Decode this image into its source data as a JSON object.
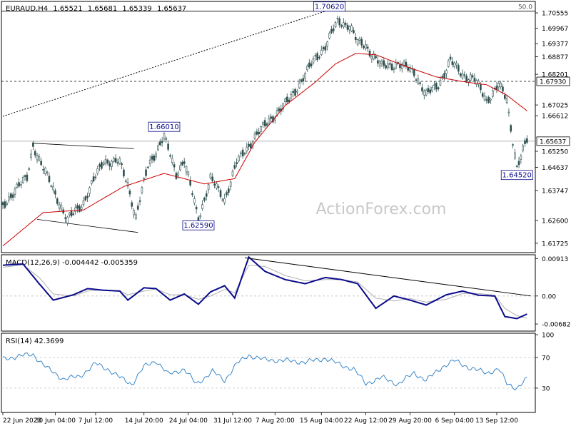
{
  "chart_data": {
    "type": "candlestick",
    "header": {
      "symbol": "EURAUD,H4",
      "open": "1.65521",
      "high": "1.65681",
      "low": "1.65339",
      "close": "1.65637"
    },
    "watermark": "ActionForex.com",
    "colors": {
      "candle": "#2f4f4f",
      "ma": "#cc0000",
      "macd": "#0a0a8c",
      "signal": "#b0b0b0",
      "rsi": "#3a87c9",
      "label_border": "#0a0a8c",
      "label_text": "#0a0a8c",
      "frame": "#000000"
    },
    "price_panel": {
      "ylim": [
        1.6142,
        1.7094
      ],
      "ticks": [
        "1.70555",
        "1.69967",
        "1.69377",
        "1.68877",
        "1.68201",
        "1.67025",
        "1.66612",
        "1.65250",
        "1.64637",
        "1.63747",
        "1.62600",
        "1.61725"
      ],
      "tick_values": [
        1.70555,
        1.69967,
        1.69377,
        1.68877,
        1.68201,
        1.67025,
        1.66612,
        1.6525,
        1.64637,
        1.63747,
        1.626,
        1.61725
      ],
      "current_price_label": "1.65637",
      "current_price": 1.65637,
      "level_label": "1.67930",
      "level": 1.6793,
      "fib_label": "50.0",
      "fib_level": 1.7062,
      "annotations": [
        {
          "label": "1.70620",
          "value": 1.7062,
          "bar": 162
        },
        {
          "label": "1.66010",
          "value": 1.6601,
          "bar": 80
        },
        {
          "label": "1.62590",
          "value": 1.6259,
          "bar": 97
        },
        {
          "label": "1.64520",
          "value": 1.6452,
          "bar": 255
        }
      ],
      "channel": [
        {
          "from": {
            "bar": 15,
            "value": 1.6556
          },
          "to": {
            "bar": 65,
            "value": 1.6535
          }
        },
        {
          "from": {
            "bar": 17,
            "value": 1.6264
          },
          "to": {
            "bar": 67,
            "value": 1.6214
          }
        }
      ],
      "trendline": {
        "from": {
          "bar": 0,
          "value": 1.6659
        },
        "to": {
          "bar": 160,
          "value": 1.7062
        }
      },
      "ma_points": [
        [
          0,
          1.6162
        ],
        [
          20,
          1.629
        ],
        [
          40,
          1.63
        ],
        [
          60,
          1.639
        ],
        [
          80,
          1.644
        ],
        [
          100,
          1.64
        ],
        [
          115,
          1.642
        ],
        [
          125,
          1.656
        ],
        [
          140,
          1.67
        ],
        [
          155,
          1.679
        ],
        [
          165,
          1.686
        ],
        [
          175,
          1.69
        ],
        [
          185,
          1.6895
        ],
        [
          200,
          1.685
        ],
        [
          215,
          1.681
        ],
        [
          230,
          1.679
        ],
        [
          240,
          1.678
        ],
        [
          250,
          1.674
        ],
        [
          260,
          1.668
        ]
      ],
      "price_points": [
        [
          0,
          1.631
        ],
        [
          6,
          1.638
        ],
        [
          12,
          1.642
        ],
        [
          15,
          1.655
        ],
        [
          20,
          1.646
        ],
        [
          25,
          1.638
        ],
        [
          32,
          1.626
        ],
        [
          40,
          1.633
        ],
        [
          50,
          1.649
        ],
        [
          58,
          1.648
        ],
        [
          62,
          1.64
        ],
        [
          66,
          1.627
        ],
        [
          72,
          1.647
        ],
        [
          80,
          1.658
        ],
        [
          86,
          1.644
        ],
        [
          90,
          1.649
        ],
        [
          97,
          1.6265
        ],
        [
          103,
          1.642
        ],
        [
          110,
          1.634
        ],
        [
          116,
          1.648
        ],
        [
          125,
          1.658
        ],
        [
          133,
          1.665
        ],
        [
          142,
          1.672
        ],
        [
          150,
          1.682
        ],
        [
          155,
          1.688
        ],
        [
          160,
          1.693
        ],
        [
          166,
          1.702
        ],
        [
          172,
          1.701
        ],
        [
          176,
          1.694
        ],
        [
          180,
          1.693
        ],
        [
          188,
          1.685
        ],
        [
          196,
          1.686
        ],
        [
          204,
          1.683
        ],
        [
          210,
          1.674
        ],
        [
          216,
          1.678
        ],
        [
          222,
          1.687
        ],
        [
          228,
          1.682
        ],
        [
          234,
          1.68
        ],
        [
          240,
          1.672
        ],
        [
          246,
          1.678
        ],
        [
          250,
          1.672
        ],
        [
          255,
          1.6465
        ],
        [
          260,
          1.6565
        ]
      ]
    },
    "macd_panel": {
      "label": "MACD(12,26,9) -0.004442 -0.005359",
      "ylim": [
        -0.0082,
        0.0097
      ],
      "ticks": [
        "0.00913",
        "0.00",
        "-0.006823"
      ],
      "tick_values": [
        0.00913,
        0.0,
        -0.006823
      ],
      "macd_points": [
        [
          0,
          0.0075
        ],
        [
          10,
          0.0078
        ],
        [
          18,
          0.003
        ],
        [
          25,
          -0.001
        ],
        [
          35,
          0.0003
        ],
        [
          42,
          0.0018
        ],
        [
          50,
          0.0014
        ],
        [
          58,
          0.0012
        ],
        [
          62,
          -0.001
        ],
        [
          70,
          0.002
        ],
        [
          76,
          0.0018
        ],
        [
          83,
          -0.001
        ],
        [
          90,
          0.0005
        ],
        [
          97,
          -0.002
        ],
        [
          103,
          0.001
        ],
        [
          110,
          0.0025
        ],
        [
          115,
          -0.0005
        ],
        [
          122,
          0.0095
        ],
        [
          130,
          0.006
        ],
        [
          140,
          0.004
        ],
        [
          150,
          0.003
        ],
        [
          160,
          0.0045
        ],
        [
          168,
          0.004
        ],
        [
          176,
          0.003
        ],
        [
          185,
          -0.003
        ],
        [
          194,
          0.0
        ],
        [
          202,
          -0.001
        ],
        [
          210,
          -0.0022
        ],
        [
          220,
          0.0003
        ],
        [
          228,
          0.0012
        ],
        [
          236,
          0.0002
        ],
        [
          244,
          0.0
        ],
        [
          249,
          -0.005
        ],
        [
          255,
          -0.0055
        ],
        [
          260,
          -0.0044
        ]
      ],
      "signal_points": [
        [
          0,
          0.007
        ],
        [
          10,
          0.0076
        ],
        [
          18,
          0.0045
        ],
        [
          25,
          0.0005
        ],
        [
          35,
          0.0
        ],
        [
          42,
          0.0012
        ],
        [
          50,
          0.0015
        ],
        [
          58,
          0.0013
        ],
        [
          62,
          0.0003
        ],
        [
          70,
          0.0012
        ],
        [
          76,
          0.0017
        ],
        [
          83,
          0.0003
        ],
        [
          90,
          0.0003
        ],
        [
          97,
          -0.0008
        ],
        [
          103,
          0.0
        ],
        [
          110,
          0.0016
        ],
        [
          115,
          0.0008
        ],
        [
          122,
          0.0075
        ],
        [
          130,
          0.0072
        ],
        [
          140,
          0.005
        ],
        [
          150,
          0.0037
        ],
        [
          160,
          0.004
        ],
        [
          168,
          0.004
        ],
        [
          176,
          0.0034
        ],
        [
          185,
          -0.0005
        ],
        [
          194,
          -0.0012
        ],
        [
          202,
          -0.0006
        ],
        [
          210,
          -0.0015
        ],
        [
          220,
          -0.0008
        ],
        [
          228,
          0.0006
        ],
        [
          236,
          0.0006
        ],
        [
          244,
          0.0002
        ],
        [
          249,
          -0.003
        ],
        [
          255,
          -0.0048
        ],
        [
          260,
          -0.0054
        ]
      ],
      "trendline": {
        "from": {
          "bar": 120,
          "value": 0.0093
        },
        "to": {
          "bar": 262,
          "value": 0.0
        }
      }
    },
    "rsi_panel": {
      "label": "RSI(14) 42.3699",
      "ylim": [
        0,
        100
      ],
      "ticks": [
        "100",
        "70",
        "30",
        "0"
      ],
      "tick_values": [
        100,
        70,
        30,
        0
      ],
      "guides": [
        70,
        30
      ],
      "rsi_points": [
        [
          0,
          68
        ],
        [
          8,
          72
        ],
        [
          15,
          74
        ],
        [
          22,
          56
        ],
        [
          30,
          42
        ],
        [
          38,
          45
        ],
        [
          46,
          62
        ],
        [
          52,
          55
        ],
        [
          58,
          44
        ],
        [
          64,
          35
        ],
        [
          70,
          58
        ],
        [
          76,
          66
        ],
        [
          82,
          48
        ],
        [
          90,
          55
        ],
        [
          96,
          35
        ],
        [
          104,
          52
        ],
        [
          110,
          40
        ],
        [
          116,
          62
        ],
        [
          122,
          73
        ],
        [
          130,
          67
        ],
        [
          140,
          66
        ],
        [
          150,
          64
        ],
        [
          160,
          69
        ],
        [
          168,
          60
        ],
        [
          174,
          55
        ],
        [
          180,
          36
        ],
        [
          188,
          44
        ],
        [
          196,
          35
        ],
        [
          204,
          50
        ],
        [
          210,
          40
        ],
        [
          218,
          58
        ],
        [
          224,
          66
        ],
        [
          232,
          56
        ],
        [
          240,
          50
        ],
        [
          246,
          55
        ],
        [
          250,
          36
        ],
        [
          255,
          30
        ],
        [
          260,
          42
        ]
      ]
    },
    "time_axis": {
      "labels": [
        "22 Jun 2023",
        "30 Jun 04:00",
        "7 Jul 12:00",
        "14 Jul 20:00",
        "24 Jul 04:00",
        "31 Jul 12:00",
        "7 Aug 20:00",
        "15 Aug 04:00",
        "22 Aug 12:00",
        "29 Aug 20:00",
        "6 Sep 04:00",
        "13 Sep 12:00"
      ],
      "label_bars": [
        0,
        26,
        46,
        70,
        92,
        114,
        135,
        158,
        180,
        202,
        224,
        245
      ]
    }
  }
}
